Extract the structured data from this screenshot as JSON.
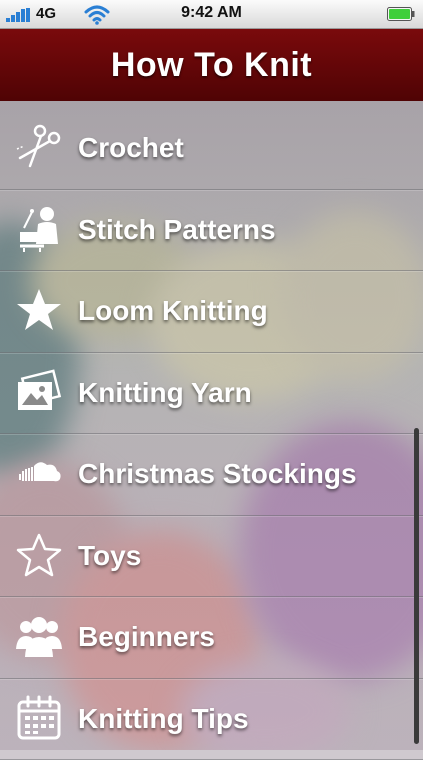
{
  "status_bar": {
    "carrier": "4G",
    "time": "9:42 AM",
    "signal_icon": "signal-bars-icon",
    "wifi_icon": "wifi-icon",
    "battery_icon": "battery-icon",
    "battery_color": "#3fcf3a"
  },
  "header": {
    "title": "How To Knit",
    "color": "#6b0507"
  },
  "menu": {
    "items": [
      {
        "label": "Crochet",
        "icon": "scissors-icon"
      },
      {
        "label": "Stitch Patterns",
        "icon": "presenter-icon"
      },
      {
        "label": "Loom Knitting",
        "icon": "star-icon"
      },
      {
        "label": "Knitting Yarn",
        "icon": "photos-icon"
      },
      {
        "label": "Christmas Stockings",
        "icon": "cloud-icon"
      },
      {
        "label": "Toys",
        "icon": "star-outline-icon"
      },
      {
        "label": "Beginners",
        "icon": "users-icon"
      },
      {
        "label": "Knitting Tips",
        "icon": "calendar-icon"
      }
    ]
  }
}
